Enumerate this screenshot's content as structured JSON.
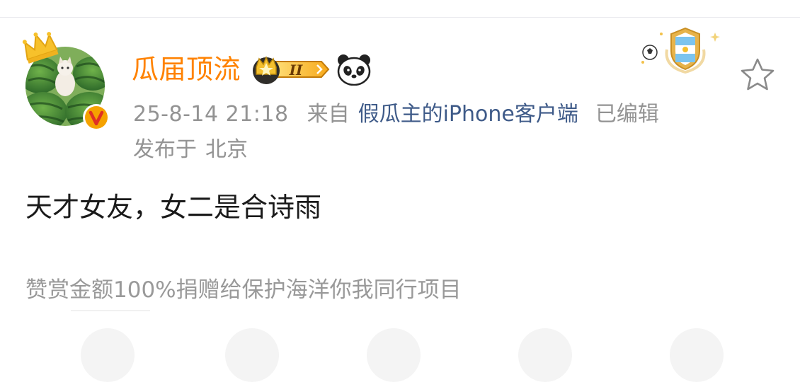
{
  "user": {
    "name": "瓜届顶流",
    "vip_level": "II",
    "avatar": "watermelon-cat-avatar",
    "verified_mark": "V"
  },
  "meta": {
    "time": "25-8-14 21:18",
    "from_label": "来自",
    "client": "假瓜主的iPhone客户端",
    "edited": "已编辑",
    "location_label": "发布于",
    "location": "北京"
  },
  "post": {
    "text": "天才女友，女二是合诗雨",
    "reward_note": "赞赏金额100%捐赠给保护海洋你我同行项目"
  },
  "icons": {
    "medal": "argentina-football-medal-icon",
    "favorite": "star-outline-icon",
    "panda": "panda-icon",
    "crown": "crown-icon"
  },
  "colors": {
    "username": "#ff8200",
    "link": "#3e5a88",
    "meta": "#939393",
    "text": "#1a1a1a",
    "reward": "#999999"
  }
}
